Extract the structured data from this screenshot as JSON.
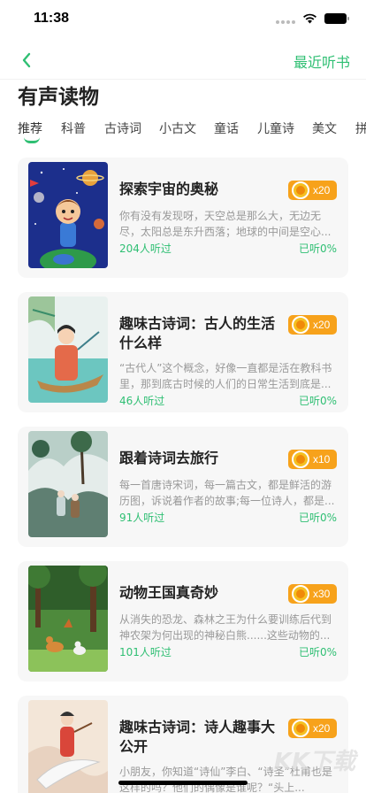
{
  "status_bar": {
    "time": "11:38"
  },
  "nav": {
    "recent_label": "最近听书"
  },
  "page": {
    "title": "有声读物"
  },
  "tabs": [
    {
      "label": "推荐",
      "active": true
    },
    {
      "label": "科普"
    },
    {
      "label": "古诗词"
    },
    {
      "label": "小古文"
    },
    {
      "label": "童话"
    },
    {
      "label": "儿童诗"
    },
    {
      "label": "美文"
    },
    {
      "label": "拼"
    }
  ],
  "books": [
    {
      "title": "探索宇宙的奥秘",
      "description": "你有没有发现呀，天空总是那么大，无边无尽，太阳总是东升西落；地球的中间是空心...",
      "listeners": "204人听过",
      "progress": "已听0%",
      "price": "x20"
    },
    {
      "title": "趣味古诗词：古人的生活什么样",
      "description": "“古代人”这个概念，好像一直都是活在教科书里，那到底古时候的人们的日常生活到底是...",
      "listeners": "46人听过",
      "progress": "已听0%",
      "price": "x20"
    },
    {
      "title": "跟着诗词去旅行",
      "description": "每一首唐诗宋词，每一篇古文，都是鲜活的游历图，诉说着作者的故事;每一位诗人，都是...",
      "listeners": "91人听过",
      "progress": "已听0%",
      "price": "x10"
    },
    {
      "title": "动物王国真奇妙",
      "description": "从消失的恐龙、森林之王为什么要训练后代到神农架为何出现的神秘白熊......这些动物的...",
      "listeners": "101人听过",
      "progress": "已听0%",
      "price": "x30"
    },
    {
      "title": "趣味古诗词：诗人趣事大公开",
      "description": "小朋友，你知道“诗仙”李白、“诗圣”杜甫也是这样的吗？他们的偶像是谁呢？“头上...",
      "listeners": "",
      "progress": "",
      "price": "x20"
    }
  ],
  "watermark": "KK下载",
  "colors": {
    "accent": "#2fbf73",
    "badge": "#f7a21b",
    "card_bg": "#f7f7f7"
  },
  "icons": {
    "back": "chevron-left-icon",
    "coin": "orange-coin-icon",
    "wifi": "wifi-icon",
    "battery": "battery-icon",
    "signal": "signal-icon"
  }
}
